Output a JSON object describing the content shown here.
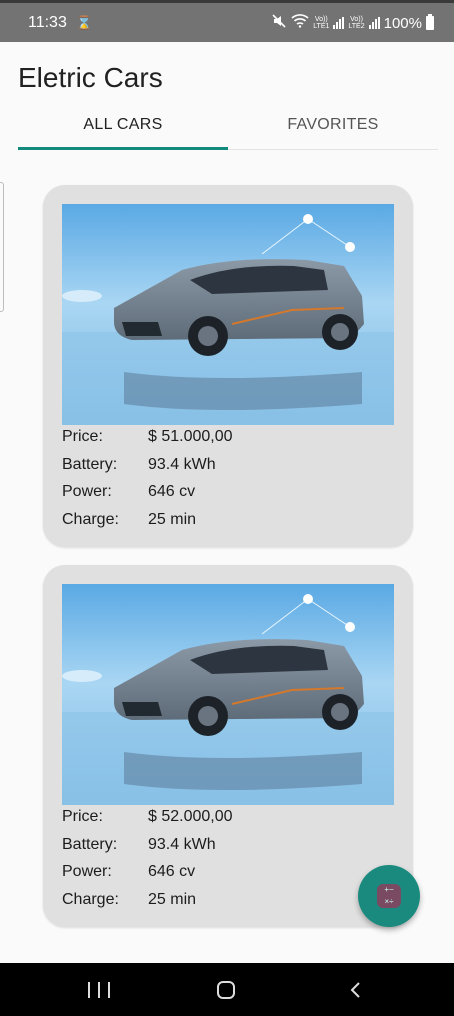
{
  "status_bar": {
    "time": "11:33",
    "volte1": "Vo))",
    "lte1": "LTE1",
    "volte2": "Vo))",
    "lte2": "LTE2",
    "battery": "100%"
  },
  "app": {
    "title": "Eletric Cars"
  },
  "tabs": [
    {
      "label": "ALL CARS",
      "selected": true
    },
    {
      "label": "FAVORITES",
      "selected": false
    }
  ],
  "spec_labels": {
    "price": "Price:",
    "battery": "Battery:",
    "power": "Power:",
    "charge": "Charge:"
  },
  "cars": [
    {
      "price": "$ 51.000,00",
      "battery": "93.4 kWh",
      "power": "646 cv",
      "charge": "25 min"
    },
    {
      "price": "$ 52.000,00",
      "battery": "93.4 kWh",
      "power": "646 cv",
      "charge": "25 min"
    }
  ],
  "fab": {
    "icon": "calculator-icon"
  },
  "navigation_bar": {
    "icons": [
      "recent-apps-icon",
      "home-icon",
      "back-icon"
    ]
  },
  "colors": {
    "accent": "#12897d",
    "fab": "#1a8a7e",
    "card": "#e0e0e0"
  }
}
